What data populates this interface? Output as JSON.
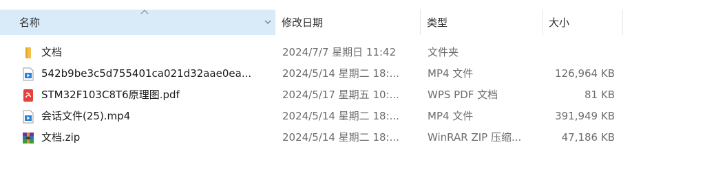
{
  "columns": {
    "name": "名称",
    "date": "修改日期",
    "type": "类型",
    "size": "大小"
  },
  "files": [
    {
      "icon": "folder-icon",
      "name": "文档",
      "date": "2024/7/7 星期日 11:42",
      "type": "文件夹",
      "size": ""
    },
    {
      "icon": "video-file-icon",
      "name": "542b9be3c5d755401ca021d32aae0ea...",
      "date": "2024/5/14 星期二 18:...",
      "type": "MP4 文件",
      "size": "126,964 KB"
    },
    {
      "icon": "pdf-file-icon",
      "name": "STM32F103C8T6原理图.pdf",
      "date": "2024/5/17 星期五 10:...",
      "type": "WPS PDF 文档",
      "size": "81 KB"
    },
    {
      "icon": "video-file-icon",
      "name": "会话文件(25).mp4",
      "date": "2024/5/14 星期二 18:...",
      "type": "MP4 文件",
      "size": "391,949 KB"
    },
    {
      "icon": "winrar-archive-icon",
      "name": "文档.zip",
      "date": "2024/5/14 星期二 18:...",
      "type": "WinRAR ZIP 压缩...",
      "size": "47,186 KB"
    }
  ]
}
